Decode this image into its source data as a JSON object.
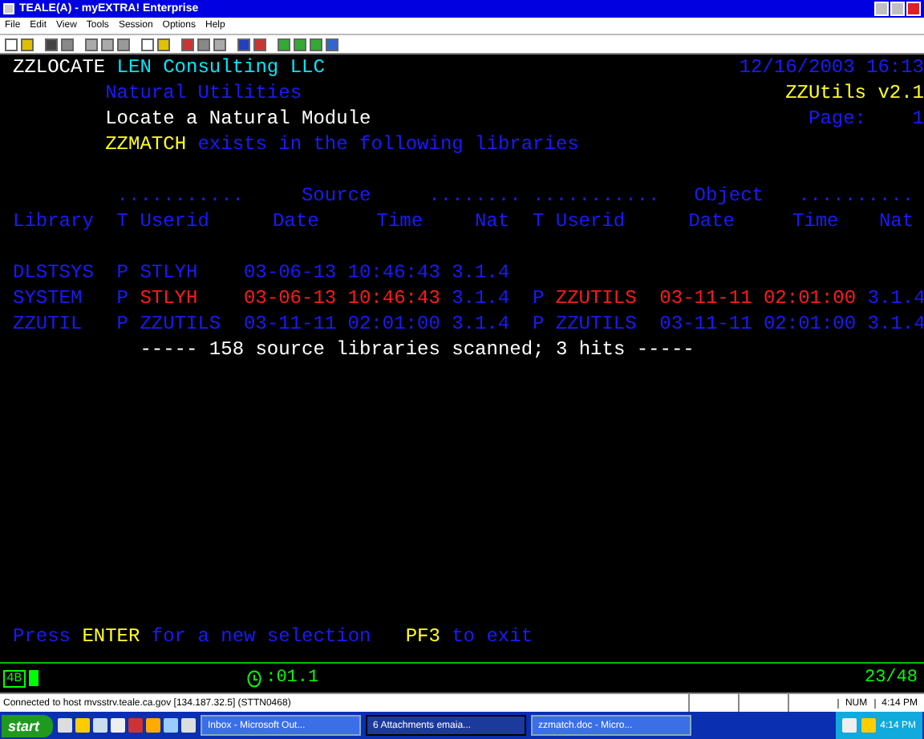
{
  "window": {
    "title": "TEALE(A) - myEXTRA! Enterprise"
  },
  "menu": [
    {
      "label": "File"
    },
    {
      "label": "Edit"
    },
    {
      "label": "View"
    },
    {
      "label": "Tools"
    },
    {
      "label": "Session"
    },
    {
      "label": "Options"
    },
    {
      "label": "Help"
    }
  ],
  "terminal": {
    "program": "ZZLOCATE",
    "company": "LEN Consulting LLC",
    "timestamp": "12/16/2003 16:13",
    "subtitle": "Natural Utilities",
    "version": "ZZUtils v2.1",
    "heading": "Locate a Natural Module",
    "page_label": "Page:",
    "page": "1",
    "module": "ZZMATCH",
    "message": "exists in the following libraries",
    "groups": [
      {
        "dots_left": "...........",
        "label": "Source",
        "dots_right": "........"
      },
      {
        "dots_left": "...........",
        "label": "Object",
        "dots_right": ".........."
      }
    ],
    "columns": [
      "Library",
      "T",
      "Userid",
      "Date",
      "Time",
      "Nat",
      "T",
      "Userid",
      "Date",
      "Time",
      "Nat"
    ],
    "rows": [
      {
        "cells": [
          {
            "text": "DLSTSYS",
            "highlighted": false
          },
          {
            "text": "P",
            "highlighted": false
          },
          {
            "text": "STLYH",
            "highlighted": false
          },
          {
            "text": "03-06-13",
            "highlighted": false
          },
          {
            "text": "10:46:43",
            "highlighted": false
          },
          {
            "text": "3.1.4",
            "highlighted": false
          }
        ]
      },
      {
        "cells": [
          {
            "text": "SYSTEM",
            "highlighted": false
          },
          {
            "text": "P",
            "highlighted": false
          },
          {
            "text": "STLYH",
            "highlighted": true
          },
          {
            "text": "03-06-13",
            "highlighted": true
          },
          {
            "text": "10:46:43",
            "highlighted": true
          },
          {
            "text": "3.1.4",
            "highlighted": false
          },
          {
            "text": "P",
            "highlighted": false
          },
          {
            "text": "ZZUTILS",
            "highlighted": true
          },
          {
            "text": "03-11-11",
            "highlighted": true
          },
          {
            "text": "02:01:00",
            "highlighted": true
          },
          {
            "text": "3.1.4",
            "highlighted": false
          }
        ]
      },
      {
        "cells": [
          {
            "text": "ZZUTIL",
            "highlighted": false
          },
          {
            "text": "P",
            "highlighted": false
          },
          {
            "text": "ZZUTILS",
            "highlighted": false
          },
          {
            "text": "03-11-11",
            "highlighted": false
          },
          {
            "text": "02:01:00",
            "highlighted": false
          },
          {
            "text": "3.1.4",
            "highlighted": false
          },
          {
            "text": "P",
            "highlighted": false
          },
          {
            "text": "ZZUTILS",
            "highlighted": false
          },
          {
            "text": "03-11-11",
            "highlighted": false
          },
          {
            "text": "02:01:00",
            "highlighted": false
          },
          {
            "text": "3.1.4",
            "highlighted": false
          }
        ]
      }
    ],
    "summary": "----- 158 source libraries scanned; 3 hits -----",
    "prompt": [
      {
        "text": "Press",
        "key": false
      },
      {
        "text": "ENTER",
        "key": true
      },
      {
        "text": "for a new selection",
        "key": false
      },
      {
        "text": "PF3",
        "key": true
      },
      {
        "text": "to exit",
        "key": false
      }
    ]
  },
  "oia": {
    "session": "4B",
    "timer": ":01.1",
    "cursor": "23/48"
  },
  "status_bar": {
    "message": "Connected to host mvsstrv.teale.ca.gov [134.187.32.5] (STTN0468)",
    "indicator": "NUM",
    "time": "4:14 PM"
  },
  "taskbar": {
    "start": "start",
    "tasks": [
      {
        "label": "Inbox - Microsoft Out...",
        "selected": false
      },
      {
        "label": "6 Attachments emaia...",
        "selected": true
      },
      {
        "label": "zzmatch.doc - Micro...",
        "selected": false
      }
    ],
    "time": "4:14 PM"
  }
}
